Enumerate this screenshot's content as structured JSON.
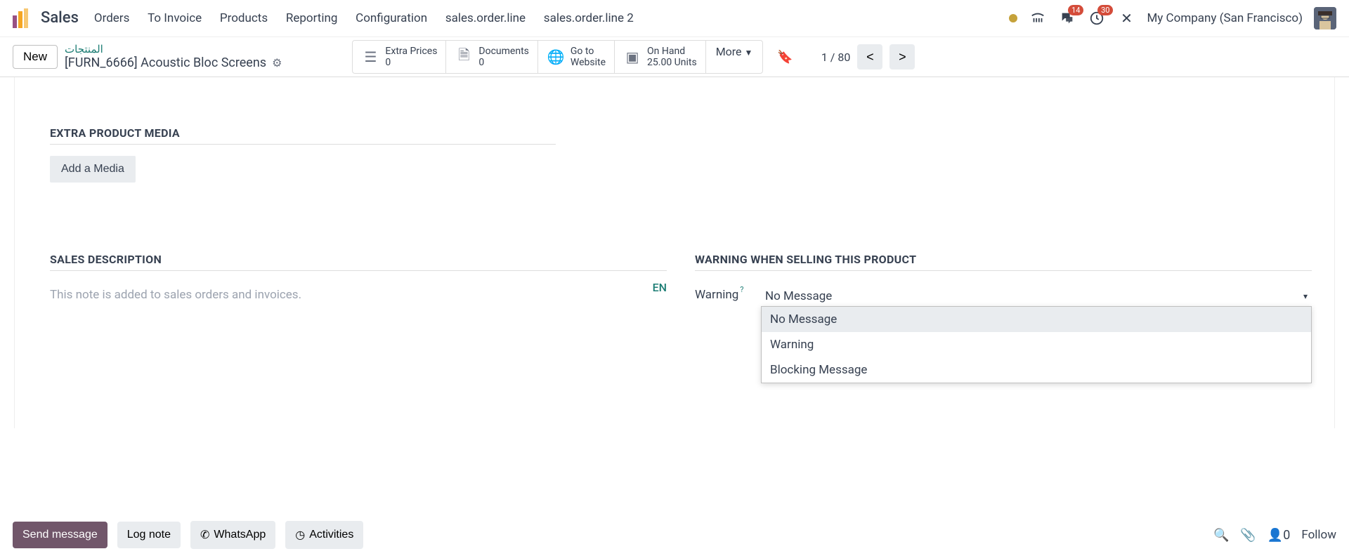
{
  "app_name": "Sales",
  "nav": [
    "Orders",
    "To Invoice",
    "Products",
    "Reporting",
    "Configuration",
    "sales.order.line",
    "sales.order.line 2"
  ],
  "tray": {
    "msg_badge": "14",
    "clock_badge": "30"
  },
  "company": "My Company (San Francisco)",
  "actionbar": {
    "new": "New",
    "crumb_parent": "المنتجات",
    "crumb_title": "[FURN_6666] Acoustic Bloc Screens"
  },
  "stats": {
    "extra_prices": {
      "label": "Extra Prices",
      "value": "0"
    },
    "documents": {
      "label": "Documents",
      "value": "0"
    },
    "goto": {
      "l1": "Go to",
      "l2": "Website"
    },
    "onhand": {
      "label": "On Hand",
      "value": "25.00 Units"
    },
    "more": "More"
  },
  "pager": {
    "text": "1 / 80"
  },
  "sections": {
    "extra_media": {
      "title": "EXTRA PRODUCT MEDIA",
      "add_btn": "Add a Media"
    },
    "sales_desc": {
      "title": "SALES DESCRIPTION",
      "placeholder": "This note is added to sales orders and invoices.",
      "lang": "EN"
    },
    "warning": {
      "title": "WARNING WHEN SELLING THIS PRODUCT",
      "label": "Warning",
      "selected": "No Message",
      "options": [
        "No Message",
        "Warning",
        "Blocking Message"
      ]
    }
  },
  "chatter": {
    "send": "Send message",
    "log": "Log note",
    "wa": "WhatsApp",
    "act": "Activities",
    "followers": "0",
    "follow": "Follow"
  }
}
